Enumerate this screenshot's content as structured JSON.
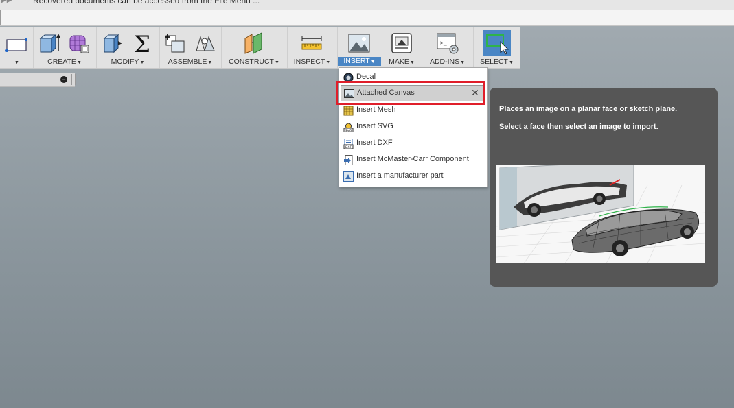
{
  "notification": {
    "message": "Recovered documents can be accessed from the File Menu ..."
  },
  "toolbar": {
    "groups": [
      {
        "label": "",
        "icons": [
          "sketch-icon"
        ]
      },
      {
        "label": "CREATE",
        "icons": [
          "extrude-box-icon",
          "form-box-icon"
        ]
      },
      {
        "label": "MODIFY",
        "icons": [
          "press-pull-icon",
          "sigma-parameters-icon"
        ]
      },
      {
        "label": "ASSEMBLE",
        "icons": [
          "new-component-icon",
          "joint-icon"
        ]
      },
      {
        "label": "CONSTRUCT",
        "icons": [
          "offset-plane-icon"
        ]
      },
      {
        "label": "INSPECT",
        "icons": [
          "measure-ruler-icon"
        ]
      },
      {
        "label": "INSERT",
        "icons": [
          "insert-image-icon"
        ],
        "active": true
      },
      {
        "label": "MAKE",
        "icons": [
          "3d-print-icon"
        ]
      },
      {
        "label": "ADD-INS",
        "icons": [
          "scripts-addins-icon"
        ]
      },
      {
        "label": "SELECT",
        "icons": [
          "select-window-icon"
        ]
      }
    ]
  },
  "insert_menu": {
    "items": [
      {
        "label": "Decal",
        "icon": "decal-icon"
      },
      {
        "label": "Attached Canvas",
        "icon": "canvas-icon",
        "highlighted": true
      },
      {
        "label": "Insert Mesh",
        "icon": "mesh-icon"
      },
      {
        "label": "Insert SVG",
        "icon": "svg-file-icon"
      },
      {
        "label": "Insert DXF",
        "icon": "dxf-file-icon"
      },
      {
        "label": "Insert McMaster-Carr Component",
        "icon": "mcmaster-icon"
      },
      {
        "label": "Insert a manufacturer part",
        "icon": "manufacturer-part-icon"
      }
    ]
  },
  "tooltip": {
    "line1": "Places an image on a planar face or sketch plane.",
    "line2": "Select a face then select an image to import."
  },
  "colors": {
    "highlight_box": "#e01e2a",
    "active_tab": "#4a86c5",
    "tooltip_bg": "#565656"
  }
}
